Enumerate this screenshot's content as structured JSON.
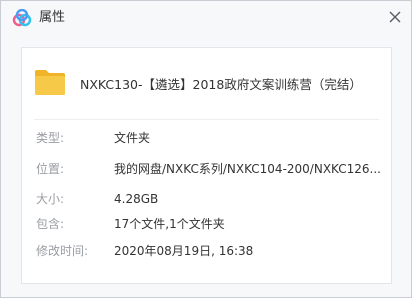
{
  "window": {
    "title": "属性",
    "close_icon": "close-icon",
    "app_icon": "baidu-netdisk-cloud-icon"
  },
  "file": {
    "icon": "folder-icon",
    "name": "NXKC130-【遴选】2018政府文案训练营（完结）"
  },
  "properties": [
    {
      "label": "类型:",
      "value": "文件夹"
    },
    {
      "label": "位置:",
      "value": "我的网盘/NXKC系列/NXKC104-200/NXKC126..."
    },
    {
      "label": "大小:",
      "value": "4.28GB"
    },
    {
      "label": "包含:",
      "value": "17个文件,1个文件夹"
    },
    {
      "label": "修改时间:",
      "value": "2020年08月19日, 16:38"
    }
  ],
  "colors": {
    "folder": "#f7c948",
    "folder_tab": "#f0b429",
    "label_text": "#9a9da3",
    "value_text": "#333333",
    "cloud_blue": "#4a9bf5",
    "cloud_pink": "#ef5d8c",
    "cloud_yellow": "#2fc1f0"
  }
}
